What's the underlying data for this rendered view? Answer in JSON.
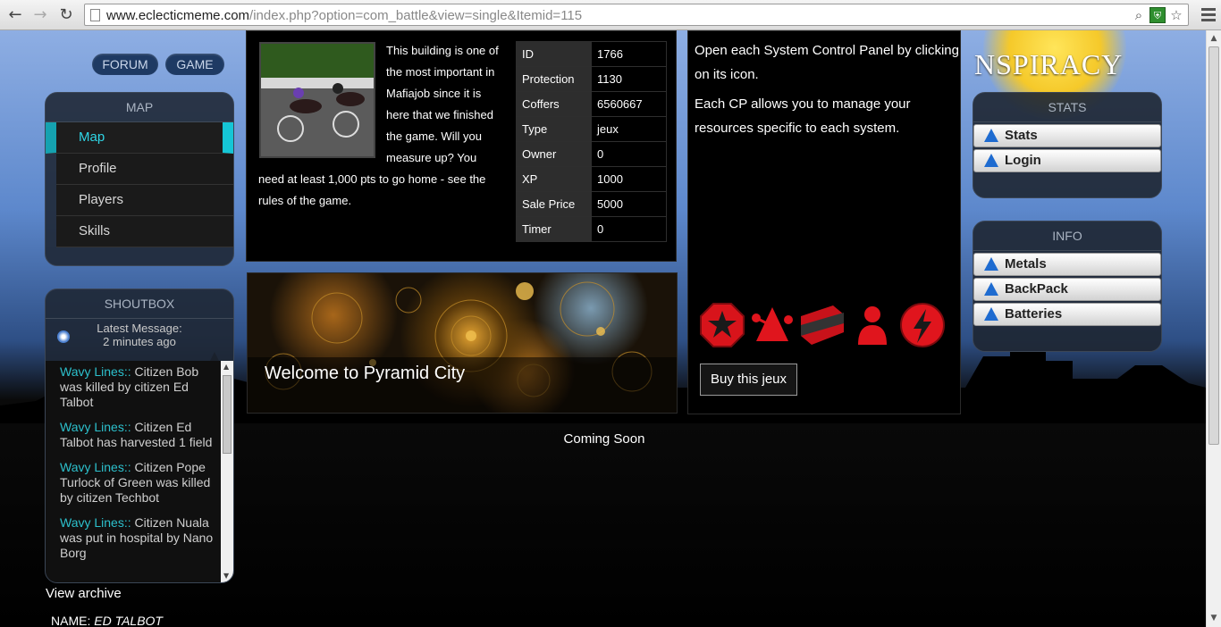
{
  "browser": {
    "url_host": "www.eclecticmeme.com",
    "url_path": "/index.php?option=com_battle&view=single&Itemid=115",
    "back_icon": "←",
    "forward_icon": "→",
    "reload_icon": "↻",
    "zoom_icon": "⌕",
    "extension_icon": "⛨",
    "star_icon": "☆"
  },
  "topnav": {
    "forum": "FORUM",
    "game": "GAME"
  },
  "map_panel": {
    "title": "MAP",
    "items": [
      {
        "label": "Map"
      },
      {
        "label": "Profile"
      },
      {
        "label": "Players"
      },
      {
        "label": "Skills"
      }
    ]
  },
  "shoutbox": {
    "title": "SHOUTBOX",
    "latest_label": "Latest Message:",
    "latest_time": "2 minutes ago",
    "messages": [
      {
        "who": "Wavy Lines::",
        "text": " Citizen Bob was killed by citizen Ed Talbot"
      },
      {
        "who": "Wavy Lines::",
        "text": " Citizen Ed Talbot has harvested 1 field"
      },
      {
        "who": "Wavy Lines::",
        "text": " Citizen Pope Turlock of Green was killed by citizen Techbot"
      },
      {
        "who": "Wavy Lines::",
        "text": " Citizen Nuala was put in hospital by Nano Borg"
      }
    ],
    "view_archive": "View archive",
    "name_label": "NAME: ",
    "name_value": "ED TALBOT"
  },
  "building": {
    "description": "This building is one of the most important in Mafiajob since it is here that we finished the game. Will you measure up? You need at least 1,000 pts to go home - see the rules of the game.",
    "stats": [
      {
        "key": "ID",
        "value": "1766"
      },
      {
        "key": "Protection",
        "value": "1130"
      },
      {
        "key": "Coffers",
        "value": "6560667"
      },
      {
        "key": "Type",
        "value": "jeux"
      },
      {
        "key": "Owner",
        "value": "0"
      },
      {
        "key": "XP",
        "value": "1000"
      },
      {
        "key": "Sale Price",
        "value": "5000"
      },
      {
        "key": "Timer",
        "value": "0"
      }
    ]
  },
  "banner": {
    "caption": "Welcome to Pyramid City"
  },
  "coming_soon": "Coming Soon",
  "control_panel": {
    "line1": "Open each System Control Panel by clicking on its icon.",
    "line2": "Each CP allows you to manage your resources specific to each system.",
    "buy_label": "Buy this jeux",
    "accent_color": "#e0151d"
  },
  "brand": "NSPIRACY",
  "stats_panel": {
    "title": "STATS",
    "items": [
      {
        "label": "Stats"
      },
      {
        "label": "Login"
      }
    ]
  },
  "info_panel": {
    "title": "INFO",
    "items": [
      {
        "label": "Metals"
      },
      {
        "label": "BackPack"
      },
      {
        "label": "Batteries"
      }
    ]
  }
}
